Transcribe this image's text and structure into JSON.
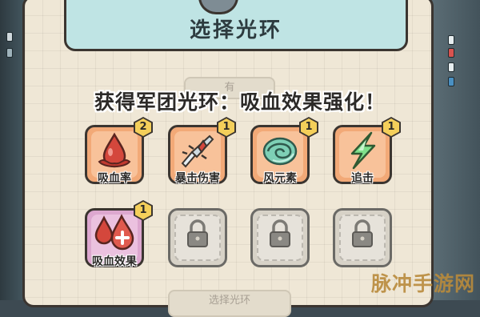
{
  "screen": {
    "title": "选择光环",
    "faded_tab_label": "有",
    "announcement": "获得军团光环：吸血效果强化！",
    "bottom_button_label": "选择光环"
  },
  "halos": [
    {
      "name": "吸血率",
      "level": "2",
      "icon": "blood-drop-icon",
      "style": "orange"
    },
    {
      "name": "暴击伤害",
      "level": "1",
      "icon": "critical-sword-icon",
      "style": "orange"
    },
    {
      "name": "风元素",
      "level": "1",
      "icon": "wind-swirl-icon",
      "style": "orange"
    },
    {
      "name": "追击",
      "level": "1",
      "icon": "lightning-bolt-icon",
      "style": "orange"
    },
    {
      "name": "吸血效果",
      "level": "1",
      "icon": "blood-drops-plus-icon",
      "style": "pink"
    },
    {
      "name": "",
      "level": "",
      "icon": "lock-icon",
      "style": "locked"
    },
    {
      "name": "",
      "level": "",
      "icon": "lock-icon",
      "style": "locked"
    },
    {
      "name": "",
      "level": "",
      "icon": "lock-icon",
      "style": "locked"
    }
  ],
  "watermark": "脉冲手游网",
  "colors": {
    "panel_bg": "#efe7d6",
    "title_banner": "#bfe4e4",
    "slot_orange": "#f2a977",
    "slot_pink": "#dda7cf",
    "badge_yellow": "#f4cf5a"
  }
}
